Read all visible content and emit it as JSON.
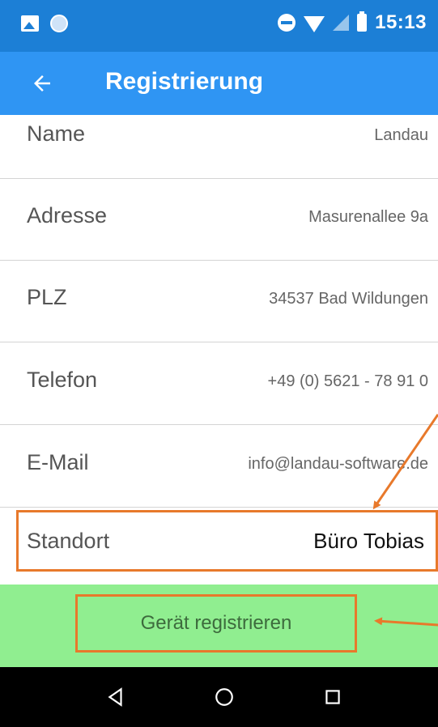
{
  "status_bar": {
    "time": "15:13",
    "icons": [
      "image-icon",
      "sync-icon",
      "do-not-disturb-icon",
      "wifi-icon",
      "signal-icon",
      "battery-charging-icon"
    ]
  },
  "app_bar": {
    "title": "Registrierung",
    "back_icon": "arrow-left-icon"
  },
  "form": {
    "rows": [
      {
        "label": "Name",
        "value": "Landau"
      },
      {
        "label": "Adresse",
        "value": "Masurenallee 9a"
      },
      {
        "label": "PLZ",
        "value": "34537 Bad Wildungen"
      },
      {
        "label": "Telefon",
        "value": "+49 (0) 5621 - 78 91 0"
      },
      {
        "label": "E-Mail",
        "value": "info@landau-software.de"
      },
      {
        "label": "Standort",
        "value": "Büro Tobias"
      }
    ]
  },
  "register_button": {
    "label": "Gerät registrieren"
  },
  "navigation": {
    "items": [
      "back-triangle-icon",
      "home-circle-icon",
      "recents-square-icon"
    ]
  },
  "colors": {
    "status_bar": "#1c7fd6",
    "app_bar": "#2f95f3",
    "register_area": "#90ee90",
    "highlight": "#e8792b",
    "nav_bar": "#000000"
  }
}
